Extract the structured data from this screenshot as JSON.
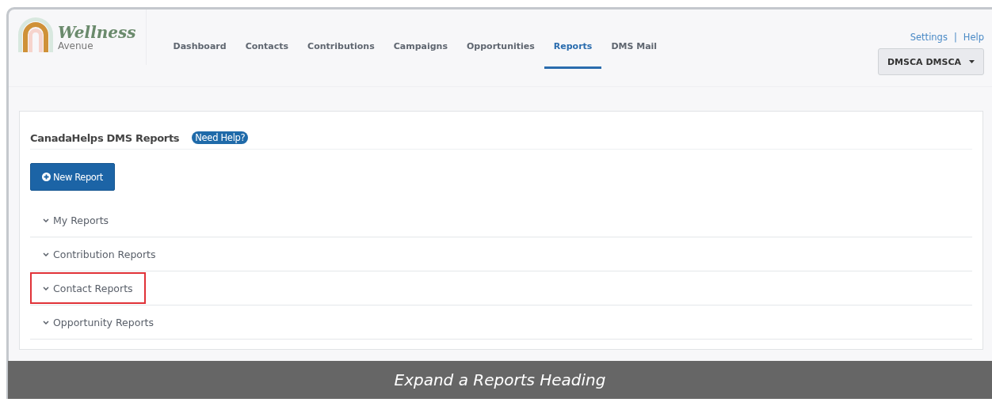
{
  "logo": {
    "name": "Wellness",
    "tagline": "Avenue"
  },
  "nav": [
    {
      "label": "Dashboard",
      "selected": false
    },
    {
      "label": "Contacts",
      "selected": false
    },
    {
      "label": "Contributions",
      "selected": false
    },
    {
      "label": "Campaigns",
      "selected": false
    },
    {
      "label": "Opportunities",
      "selected": false
    },
    {
      "label": "Reports",
      "selected": true
    },
    {
      "label": "DMS Mail",
      "selected": false
    }
  ],
  "top_links": [
    "Settings",
    "Help"
  ],
  "top_links_separator": "|",
  "user_menu": {
    "label": "DMSCA DMSCA"
  },
  "panel": {
    "title": "CanadaHelps DMS Reports",
    "help_badge": "Need Help?",
    "new_button": "New Report",
    "sections": [
      {
        "label": "My Reports",
        "highlighted": false
      },
      {
        "label": "Contribution Reports",
        "highlighted": false
      },
      {
        "label": "Contact Reports",
        "highlighted": true
      },
      {
        "label": "Opportunity Reports",
        "highlighted": false
      }
    ]
  },
  "caption": "Expand a Reports Heading"
}
